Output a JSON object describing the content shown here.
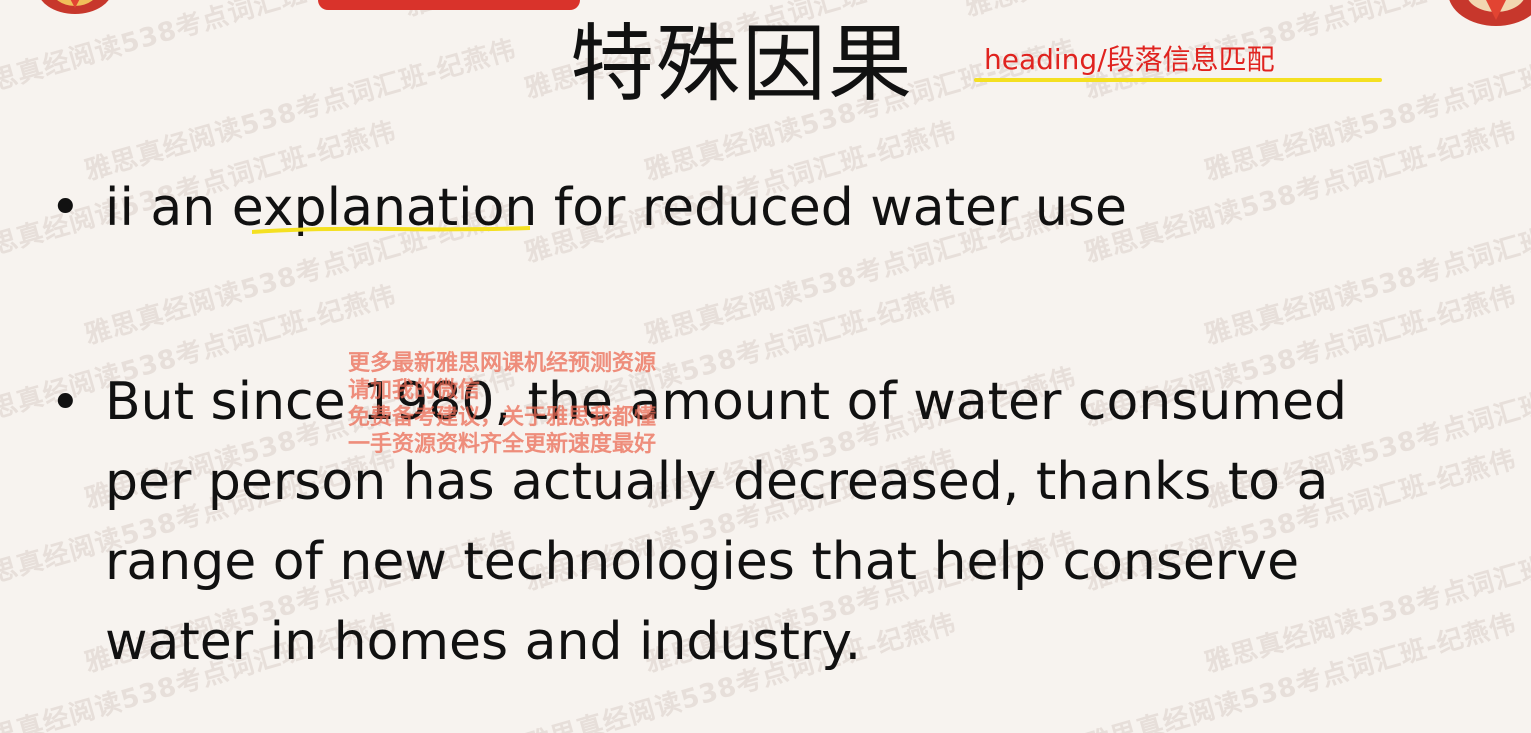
{
  "slide": {
    "title": "特殊因果",
    "annotation": "heading/段落信息匹配",
    "bullets": [
      {
        "lines": [
          "ii an explanation for reduced water use"
        ],
        "keyword": "explanation"
      },
      {
        "lines": [
          "But since 1980, the amount of water consumed",
          "per person has actually decreased, thanks to a",
          "range of new technologies that help conserve",
          "water in homes and industry."
        ]
      }
    ]
  },
  "watermark": {
    "text": "雅思真经阅读538考点词汇班-纪燕伟"
  },
  "overlay_promo": {
    "lines": [
      "更多最新雅思网课机经预测资源",
      "请加我的微信",
      "免费备考建议，关于雅思我都懂",
      "一手资源资料齐全更新速度最好"
    ]
  },
  "colors": {
    "background": "#f7f3ef",
    "title_annotation": "#e0231f",
    "highlight_underline": "#f4e021",
    "promo_text": "#ec6b55",
    "top_bar": "#d9332b"
  },
  "icons": {
    "top_left": "logo-emblem-icon",
    "top_right": "logo-emblem-icon"
  }
}
